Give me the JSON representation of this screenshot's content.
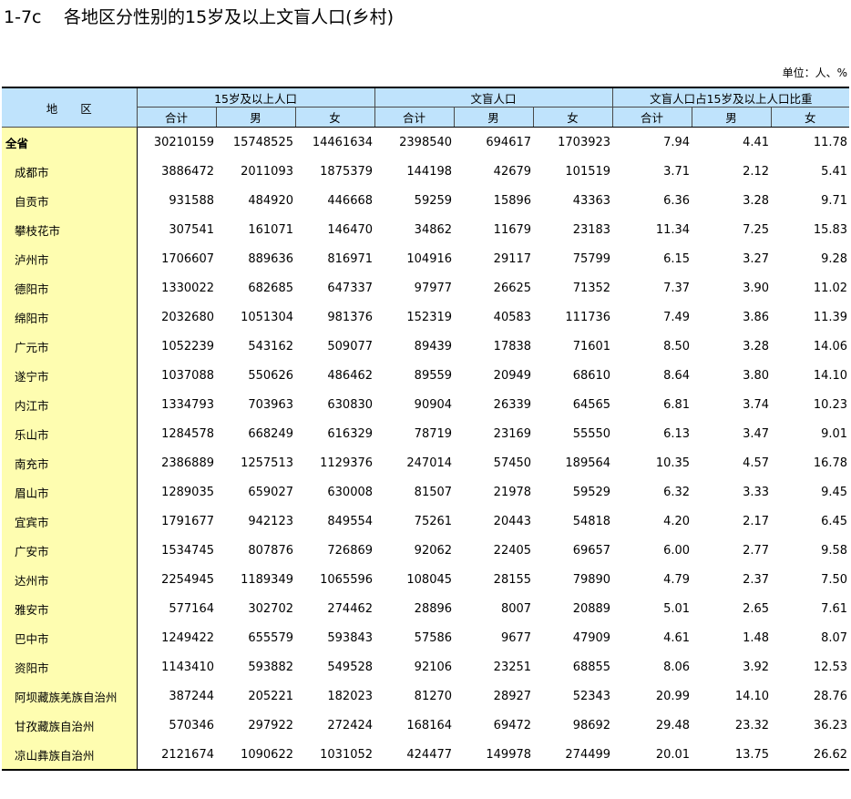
{
  "title": {
    "code": "1-7c",
    "text": "各地区分性别的15岁及以上文盲人口(乡村)"
  },
  "unit": "单位：人、%",
  "headers": {
    "region": "地　　区",
    "groups": [
      "15岁及以上人口",
      "文盲人口",
      "文盲人口占15岁及以上人口比重"
    ],
    "sub": [
      "合计",
      "男",
      "女",
      "合计",
      "男",
      "女",
      "合计",
      "男",
      "女"
    ]
  },
  "rows": [
    {
      "name": "全省",
      "values": [
        "30210159",
        "15748525",
        "14461634",
        "2398540",
        "694617",
        "1703923",
        "7.94",
        "4.41",
        "11.78"
      ]
    },
    {
      "name": "成都市",
      "values": [
        "3886472",
        "2011093",
        "1875379",
        "144198",
        "42679",
        "101519",
        "3.71",
        "2.12",
        "5.41"
      ]
    },
    {
      "name": "自贡市",
      "values": [
        "931588",
        "484920",
        "446668",
        "59259",
        "15896",
        "43363",
        "6.36",
        "3.28",
        "9.71"
      ]
    },
    {
      "name": "攀枝花市",
      "values": [
        "307541",
        "161071",
        "146470",
        "34862",
        "11679",
        "23183",
        "11.34",
        "7.25",
        "15.83"
      ]
    },
    {
      "name": "泸州市",
      "values": [
        "1706607",
        "889636",
        "816971",
        "104916",
        "29117",
        "75799",
        "6.15",
        "3.27",
        "9.28"
      ]
    },
    {
      "name": "德阳市",
      "values": [
        "1330022",
        "682685",
        "647337",
        "97977",
        "26625",
        "71352",
        "7.37",
        "3.90",
        "11.02"
      ]
    },
    {
      "name": "绵阳市",
      "values": [
        "2032680",
        "1051304",
        "981376",
        "152319",
        "40583",
        "111736",
        "7.49",
        "3.86",
        "11.39"
      ]
    },
    {
      "name": "广元市",
      "values": [
        "1052239",
        "543162",
        "509077",
        "89439",
        "17838",
        "71601",
        "8.50",
        "3.28",
        "14.06"
      ]
    },
    {
      "name": "遂宁市",
      "values": [
        "1037088",
        "550626",
        "486462",
        "89559",
        "20949",
        "68610",
        "8.64",
        "3.80",
        "14.10"
      ]
    },
    {
      "name": "内江市",
      "values": [
        "1334793",
        "703963",
        "630830",
        "90904",
        "26339",
        "64565",
        "6.81",
        "3.74",
        "10.23"
      ]
    },
    {
      "name": "乐山市",
      "values": [
        "1284578",
        "668249",
        "616329",
        "78719",
        "23169",
        "55550",
        "6.13",
        "3.47",
        "9.01"
      ]
    },
    {
      "name": "南充市",
      "values": [
        "2386889",
        "1257513",
        "1129376",
        "247014",
        "57450",
        "189564",
        "10.35",
        "4.57",
        "16.78"
      ]
    },
    {
      "name": "眉山市",
      "values": [
        "1289035",
        "659027",
        "630008",
        "81507",
        "21978",
        "59529",
        "6.32",
        "3.33",
        "9.45"
      ]
    },
    {
      "name": "宜宾市",
      "values": [
        "1791677",
        "942123",
        "849554",
        "75261",
        "20443",
        "54818",
        "4.20",
        "2.17",
        "6.45"
      ]
    },
    {
      "name": "广安市",
      "values": [
        "1534745",
        "807876",
        "726869",
        "92062",
        "22405",
        "69657",
        "6.00",
        "2.77",
        "9.58"
      ]
    },
    {
      "name": "达州市",
      "values": [
        "2254945",
        "1189349",
        "1065596",
        "108045",
        "28155",
        "79890",
        "4.79",
        "2.37",
        "7.50"
      ]
    },
    {
      "name": "雅安市",
      "values": [
        "577164",
        "302702",
        "274462",
        "28896",
        "8007",
        "20889",
        "5.01",
        "2.65",
        "7.61"
      ]
    },
    {
      "name": "巴中市",
      "values": [
        "1249422",
        "655579",
        "593843",
        "57586",
        "9677",
        "47909",
        "4.61",
        "1.48",
        "8.07"
      ]
    },
    {
      "name": "资阳市",
      "values": [
        "1143410",
        "593882",
        "549528",
        "92106",
        "23251",
        "68855",
        "8.06",
        "3.92",
        "12.53"
      ]
    },
    {
      "name": "阿坝藏族羌族自治州",
      "values": [
        "387244",
        "205221",
        "182023",
        "81270",
        "28927",
        "52343",
        "20.99",
        "14.10",
        "28.76"
      ]
    },
    {
      "name": "甘孜藏族自治州",
      "values": [
        "570346",
        "297922",
        "272424",
        "168164",
        "69472",
        "98692",
        "29.48",
        "23.32",
        "36.23"
      ]
    },
    {
      "name": "凉山彝族自治州",
      "values": [
        "2121674",
        "1090622",
        "1031052",
        "424477",
        "149978",
        "274499",
        "20.01",
        "13.75",
        "26.62"
      ]
    }
  ]
}
